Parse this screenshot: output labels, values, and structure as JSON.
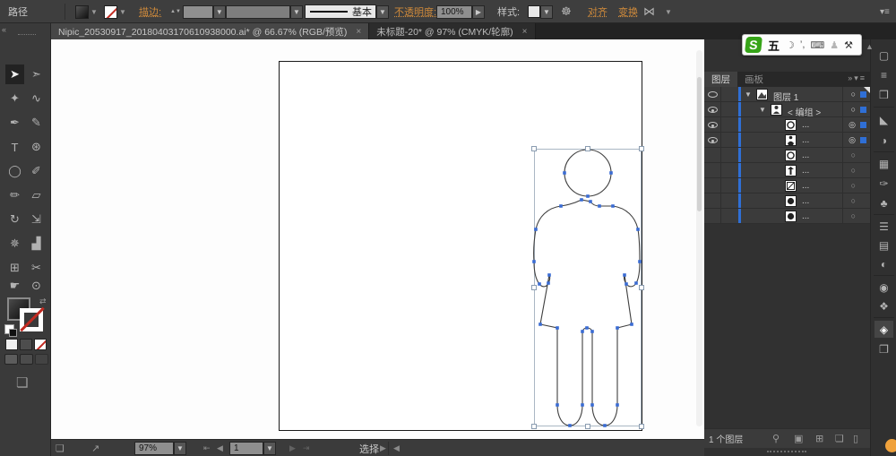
{
  "control_bar": {
    "selection_type_label": "路径",
    "stroke_link": "描边:",
    "stroke_weight_value": "",
    "variable_width_value": "",
    "brush_definition": "基本",
    "opacity_link": "不透明度:",
    "opacity_value": "100%",
    "style_label": "样式:",
    "align_link": "对齐",
    "transform_link": "变换"
  },
  "tabs": [
    {
      "title": "Nipic_20530917_20180403170610938000.ai* @ 66.67% (RGB/预览)",
      "close": "×"
    },
    {
      "title": "未标题-20* @ 97% (CMYK/轮廓)",
      "close": "×"
    }
  ],
  "tools": [
    {
      "name": "selection",
      "glyph": "➤"
    },
    {
      "name": "direct-selection",
      "glyph": "➣"
    },
    {
      "name": "magic-wand",
      "glyph": "✦"
    },
    {
      "name": "lasso",
      "glyph": "∿"
    },
    {
      "name": "pen",
      "glyph": "✒"
    },
    {
      "name": "curvature",
      "glyph": "✎"
    },
    {
      "name": "type",
      "glyph": "T"
    },
    {
      "name": "shapes",
      "glyph": "⊛"
    },
    {
      "name": "ellipse",
      "glyph": "◯"
    },
    {
      "name": "paintbrush",
      "glyph": "✐"
    },
    {
      "name": "pencil",
      "glyph": "✏"
    },
    {
      "name": "eraser",
      "glyph": "▱"
    },
    {
      "name": "rotate",
      "glyph": "↻"
    },
    {
      "name": "scale",
      "glyph": "⇲"
    },
    {
      "name": "symbol-sprayer",
      "glyph": "✵"
    },
    {
      "name": "column-graph",
      "glyph": "▟"
    },
    {
      "name": "artboard",
      "glyph": "⊞"
    },
    {
      "name": "slice",
      "glyph": "✂"
    },
    {
      "name": "hand",
      "glyph": "☛"
    },
    {
      "name": "zoom",
      "glyph": "⊙"
    }
  ],
  "dock_panels": [
    {
      "name": "transform",
      "glyph": "▢"
    },
    {
      "name": "align",
      "glyph": "≡"
    },
    {
      "name": "pathfinder",
      "glyph": "❒"
    },
    {
      "name": "gradient-mesh",
      "glyph": "◣"
    },
    {
      "name": "color",
      "glyph": "◑"
    },
    {
      "name": "swatches",
      "glyph": "▦"
    },
    {
      "name": "brushes",
      "glyph": "✑"
    },
    {
      "name": "symbols",
      "glyph": "♣"
    },
    {
      "name": "stroke",
      "glyph": "☰"
    },
    {
      "name": "gradient",
      "glyph": "▤"
    },
    {
      "name": "transparency",
      "glyph": "◐"
    },
    {
      "name": "appearance",
      "glyph": "◉"
    },
    {
      "name": "graphic-styles",
      "glyph": "❖"
    },
    {
      "name": "layers",
      "glyph": "◈"
    },
    {
      "name": "artboards",
      "glyph": "❐"
    }
  ],
  "layers_panel": {
    "tab_layers": "图层",
    "tab_artboards": "画板",
    "panel_icons": "»▾≡",
    "rows": [
      {
        "name": "图层 1",
        "twirl": "▼",
        "target_glyph": "○",
        "indent": 0,
        "visible": true,
        "selected": true,
        "thumb": "layer"
      },
      {
        "name": "< 编组 >",
        "twirl": "▼",
        "target_glyph": "○",
        "indent": 1,
        "visible": true,
        "selected": true,
        "thumb": "group"
      },
      {
        "name": "...",
        "twirl": "",
        "target_glyph": "◎",
        "indent": 2,
        "visible": true,
        "selected": true,
        "thumb": "circle"
      },
      {
        "name": "...",
        "twirl": "",
        "target_glyph": "◎",
        "indent": 2,
        "visible": true,
        "selected": true,
        "thumb": "figure"
      },
      {
        "name": "...",
        "twirl": "",
        "target_glyph": "○",
        "indent": 2,
        "visible": false,
        "selected": false,
        "thumb": "circle"
      },
      {
        "name": "...",
        "twirl": "",
        "target_glyph": "○",
        "indent": 2,
        "visible": false,
        "selected": false,
        "thumb": "figure"
      },
      {
        "name": "...",
        "twirl": "",
        "target_glyph": "○",
        "indent": 2,
        "visible": false,
        "selected": false,
        "thumb": "square"
      },
      {
        "name": "...",
        "twirl": "",
        "target_glyph": "○",
        "indent": 2,
        "visible": false,
        "selected": false,
        "thumb": "circle"
      },
      {
        "name": "...",
        "twirl": "",
        "target_glyph": "○",
        "indent": 2,
        "visible": false,
        "selected": false,
        "thumb": "circle"
      }
    ],
    "footer_count": "1 个图层",
    "footer_icons": [
      {
        "name": "locate-object",
        "glyph": "⚲"
      },
      {
        "name": "make-clipping-mask",
        "glyph": "▣"
      },
      {
        "name": "new-sublayer",
        "glyph": "⊞"
      },
      {
        "name": "new-layer",
        "glyph": "❏"
      },
      {
        "name": "delete-layer",
        "glyph": "▯"
      }
    ]
  },
  "status_bar": {
    "zoom_value": "97%",
    "artboard_nav_value": "1",
    "tool_name": "选择"
  },
  "ime_bar": {
    "logo": "S",
    "mode": "五",
    "moon": "☽",
    "punct": "’,",
    "keyboard": "⌨",
    "user": "♟",
    "wrench": "⚒",
    "collapse": "▲"
  },
  "icons": {
    "chevron_down": "▼",
    "chevron_right": "▶",
    "chevron_left": "◀",
    "stepper": "▲▼",
    "swap": "⇄",
    "wheel": "☸",
    "shear": "⋈",
    "panel_menu": "▾≡",
    "collapse_left": "«",
    "first": "⇤",
    "prev": "◀",
    "next": "▶",
    "last": "⇥",
    "launch": "❏",
    "share": "↗",
    "accent_blue": "#2f6fd6",
    "link_orange": "#cf8a3b"
  }
}
